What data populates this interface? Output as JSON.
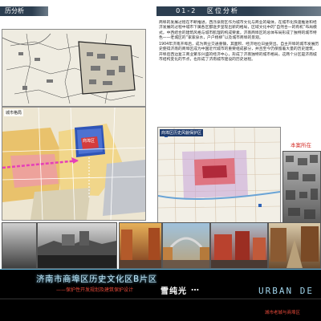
{
  "header": {
    "left_tag": "历分析",
    "section_number": "01-2",
    "section_title": "区位分析"
  },
  "text_block": {
    "paragraph_1": "商埠的发展过程在不断推进，西泺泉街区作为城市文化与商业的载体，在城市化快速推进和经济发展的过程中城市下属各区都逐步呈现出新的格局，区域文化中的“自然合一的有机”布局模式，中西结合的建筑风格与城市肌理的构成要素，济南商埠区的总体布局形成了独特的城市特色——老城区的“家家泉水，户户杨柳”以及城市商埠的景观。",
    "paragraph_2": "1904年济南开埠后，成为商业交通重镇，其面积、经济地位日益突出。自主开埠的城市发展历史使得济南的商埠区成为中国近代城市的重要组成部分，并且至今仍保留着大量的历史建筑，开埠后西边复工商业繁华兴盛的经济中心，形成了济南独特的城市格局，这两个分区是济南城市结构变化的节点，也形成了济南城市建设的历史进程。"
  },
  "maps": {
    "old_map_caption": "城市格局",
    "zoning_label": "商埠区",
    "protection_map_title": "商埠区历史风貌保护区",
    "site_label": "本案所在"
  },
  "footer": {
    "title": "济南市商埠区历史文化区B片区",
    "subtitle": "——保护性开发规划及建筑保护设计",
    "brand": "雪纯光",
    "ellipsis": "…",
    "urban": "URBAN DE",
    "note": "城市老城与商埠区"
  }
}
